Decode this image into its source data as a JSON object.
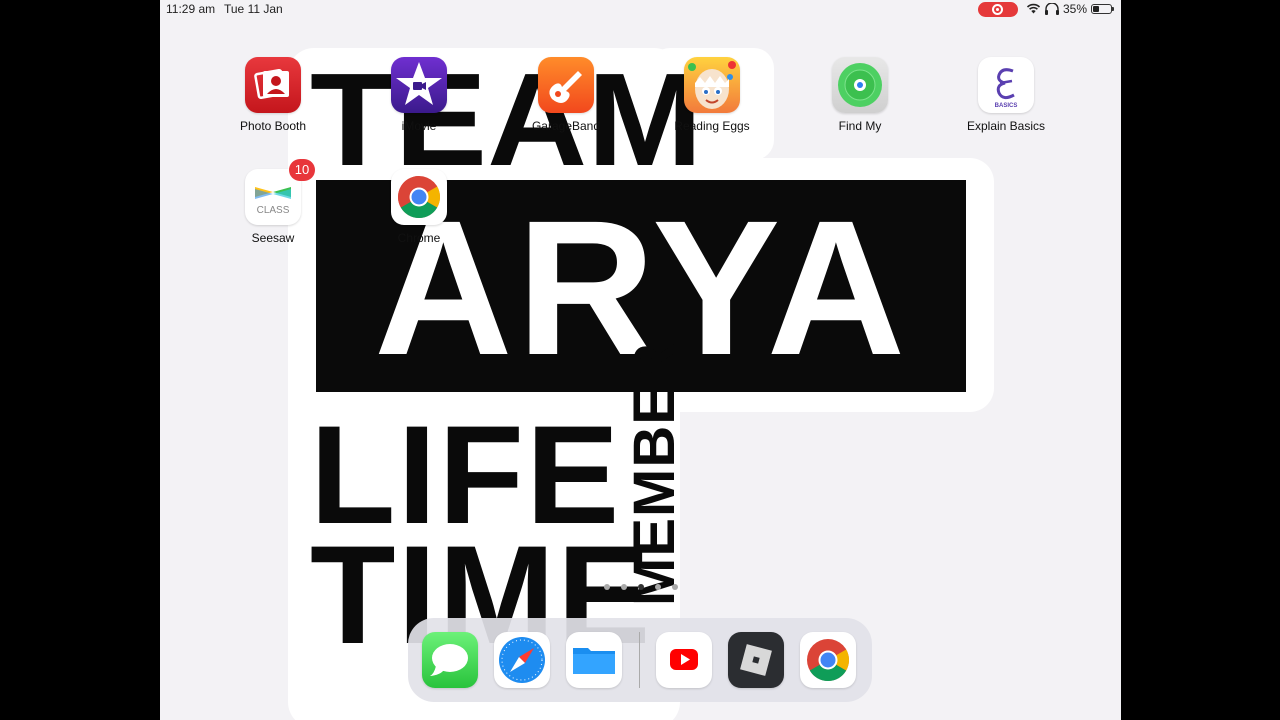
{
  "status_bar": {
    "time": "11:29 am",
    "date": "Tue 11 Jan",
    "battery": "35%",
    "recording": true
  },
  "wallpaper": {
    "line1": "TEAM",
    "line2": "ARYA",
    "line3": "LIFE",
    "line4": "TIME",
    "line5": "MEMBER"
  },
  "apps": [
    {
      "label": "Photo Booth",
      "icon": "photo-booth-icon"
    },
    {
      "label": "iMovie",
      "icon": "imovie-icon"
    },
    {
      "label": "GarageBand",
      "icon": "garageband-icon"
    },
    {
      "label": "Reading Eggs",
      "icon": "reading-eggs-icon"
    },
    {
      "label": "Find My",
      "icon": "find-my-icon"
    },
    {
      "label": "Explain Basics",
      "icon": "explain-basics-icon"
    },
    {
      "label": "Seesaw",
      "icon": "seesaw-icon",
      "badge": "10"
    },
    {
      "label": "Chrome",
      "icon": "chrome-icon"
    }
  ],
  "explain_icon_text": "BASICS",
  "seesaw_icon_text": "CLASS",
  "page_indicator": {
    "pages": 5,
    "current": 3
  },
  "dock": [
    {
      "name": "Messages",
      "icon": "messages-icon"
    },
    {
      "name": "Safari",
      "icon": "safari-icon"
    },
    {
      "name": "Files",
      "icon": "files-icon"
    },
    {
      "name": "YouTube",
      "icon": "youtube-icon"
    },
    {
      "name": "Roblox",
      "icon": "roblox-icon"
    },
    {
      "name": "Chrome",
      "icon": "chrome-icon"
    }
  ]
}
